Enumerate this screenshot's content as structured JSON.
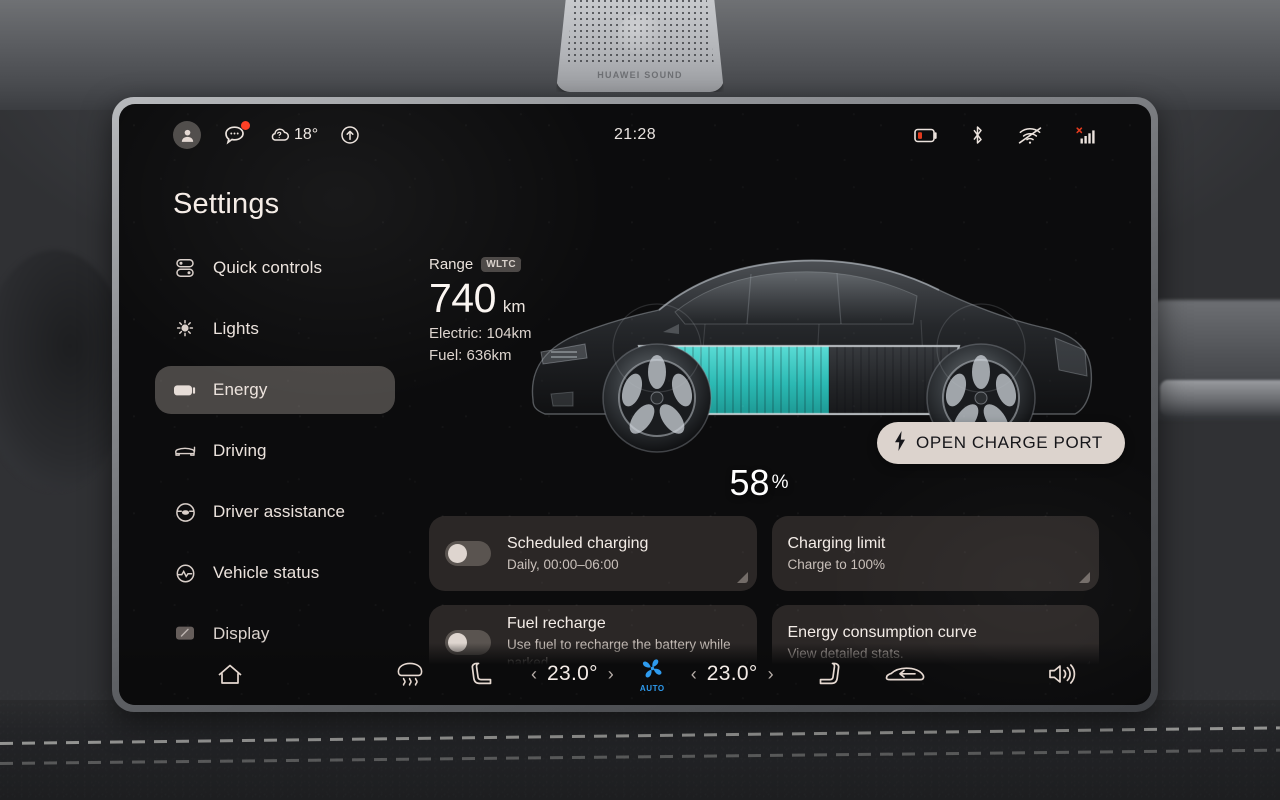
{
  "hardware": {
    "speaker_label": "HUAWEI SOUND"
  },
  "statusbar": {
    "avatar_icon": "user-avatar-icon",
    "message_icon": "message-bubble-icon",
    "message_badge": true,
    "weather_icon": "cloud-icon",
    "temperature": "18°",
    "nav_icon": "navigation-arrow-icon",
    "time": "21:28",
    "battery_icon": "battery-low-icon",
    "bluetooth_icon": "bluetooth-icon",
    "wifi_icon": "wifi-off-icon",
    "cellular_icon": "cellular-no-signal-icon"
  },
  "page": {
    "title": "Settings"
  },
  "sidebar": {
    "items": [
      {
        "label": "Quick controls",
        "icon": "toggles-icon",
        "active": false
      },
      {
        "label": "Lights",
        "icon": "light-bulb-icon",
        "active": false
      },
      {
        "label": "Energy",
        "icon": "battery-icon",
        "active": true
      },
      {
        "label": "Driving",
        "icon": "car-icon",
        "active": false
      },
      {
        "label": "Driver assistance",
        "icon": "steering-wheel-icon",
        "active": false
      },
      {
        "label": "Vehicle status",
        "icon": "vehicle-status-icon",
        "active": false
      },
      {
        "label": "Display",
        "icon": "display-icon",
        "active": false
      }
    ]
  },
  "energy": {
    "range_label": "Range",
    "range_standard": "WLTC",
    "range_value": "740",
    "range_unit": "km",
    "electric_range": "Electric: 104km",
    "fuel_range": "Fuel: 636km",
    "battery_percent": "58",
    "battery_percent_symbol": "%",
    "battery_fill_ratio": 0.58,
    "charge_port_button": "OPEN CHARGE PORT",
    "charge_port_icon": "lightning-bolt-icon",
    "accent_color": "#3ecfc8"
  },
  "cards": [
    {
      "title": "Scheduled charging",
      "subtitle": "Daily, 00:00–06:00",
      "has_toggle": true,
      "toggle_on": false,
      "resize_handle": true
    },
    {
      "title": "Charging limit",
      "subtitle": "Charge to 100%",
      "has_toggle": false,
      "toggle_on": false,
      "resize_handle": true
    },
    {
      "title": "Fuel recharge",
      "subtitle": "Use fuel to recharge the battery while parked.",
      "has_toggle": true,
      "toggle_on": false,
      "resize_handle": true
    },
    {
      "title": "Energy consumption curve",
      "subtitle": "View detailed stats.",
      "has_toggle": false,
      "toggle_on": false,
      "resize_handle": true
    }
  ],
  "climate": {
    "home_icon": "home-icon",
    "defrost_icon": "front-defrost-icon",
    "seat_left_icon": "seat-heater-left-icon",
    "temp_left_decrease": "‹",
    "temp_left": "23.0°",
    "temp_left_increase": "›",
    "fan_icon": "fan-icon",
    "fan_mode": "AUTO",
    "fan_color": "#2e9bef",
    "temp_right_decrease": "‹",
    "temp_right": "23.0°",
    "temp_right_increase": "›",
    "seat_right_icon": "seat-heater-right-icon",
    "recirculation_icon": "air-recirculation-icon",
    "volume_icon": "volume-icon"
  }
}
